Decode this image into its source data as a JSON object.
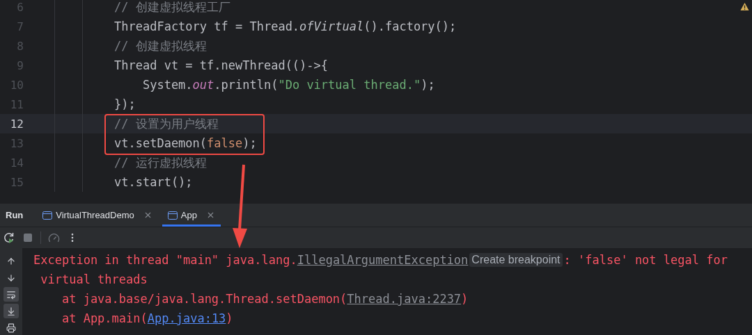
{
  "editor": {
    "warning": true,
    "lines": [
      {
        "number": "6",
        "current": false,
        "tokens": [
          {
            "kind": "comment",
            "text": "// 创建虚拟线程工厂"
          }
        ]
      },
      {
        "number": "7",
        "current": false,
        "tokens": [
          {
            "kind": "plain",
            "text": "ThreadFactory tf = Thread."
          },
          {
            "kind": "italic",
            "text": "ofVirtual"
          },
          {
            "kind": "plain",
            "text": "().factory();"
          }
        ]
      },
      {
        "number": "8",
        "current": false,
        "tokens": [
          {
            "kind": "comment",
            "text": "// 创建虚拟线程"
          }
        ]
      },
      {
        "number": "9",
        "current": false,
        "tokens": [
          {
            "kind": "plain",
            "text": "Thread vt = tf.newThread(()->{"
          }
        ]
      },
      {
        "number": "10",
        "current": false,
        "tokens": [
          {
            "kind": "plain",
            "text": "    System."
          },
          {
            "kind": "field",
            "text": "out"
          },
          {
            "kind": "plain",
            "text": ".println("
          },
          {
            "kind": "string",
            "text": "\"Do virtual thread.\""
          },
          {
            "kind": "plain",
            "text": ");"
          }
        ]
      },
      {
        "number": "11",
        "current": false,
        "tokens": [
          {
            "kind": "plain",
            "text": "});"
          }
        ]
      },
      {
        "number": "12",
        "current": true,
        "tokens": [
          {
            "kind": "comment",
            "text": "// 设置为用户线程"
          }
        ]
      },
      {
        "number": "13",
        "current": false,
        "tokens": [
          {
            "kind": "plain",
            "text": "vt.setDaemon("
          },
          {
            "kind": "keyword",
            "text": "false"
          },
          {
            "kind": "plain",
            "text": ");"
          }
        ]
      },
      {
        "number": "14",
        "current": false,
        "tokens": [
          {
            "kind": "comment",
            "text": "// 运行虚拟线程"
          }
        ]
      },
      {
        "number": "15",
        "current": false,
        "tokens": [
          {
            "kind": "plain",
            "text": "vt.start();"
          }
        ]
      }
    ]
  },
  "run_panel": {
    "title": "Run",
    "tabs": [
      {
        "label": "VirtualThreadDemo",
        "selected": false
      },
      {
        "label": "App",
        "selected": true
      }
    ],
    "toolbar": [
      {
        "kind": "rerun",
        "disabled": false
      },
      {
        "kind": "stop",
        "disabled": true
      },
      {
        "kind": "separator"
      },
      {
        "kind": "profiler",
        "disabled": true
      },
      {
        "kind": "more",
        "disabled": false
      }
    ],
    "side_actions": [
      {
        "kind": "up",
        "selected": false
      },
      {
        "kind": "down",
        "selected": false
      },
      {
        "kind": "wrap",
        "selected": true
      },
      {
        "kind": "scroll_end",
        "selected": true
      },
      {
        "kind": "print",
        "selected": false
      }
    ],
    "console": [
      [
        {
          "kind": "error",
          "text": "Exception in thread \"main\" java.lang."
        },
        {
          "kind": "source",
          "text": "IllegalArgumentException"
        },
        {
          "kind": "hint",
          "text": "Create breakpoint"
        },
        {
          "kind": "error",
          "text": ": 'false' not legal for"
        }
      ],
      [
        {
          "kind": "error",
          "text": " virtual threads"
        }
      ],
      [
        {
          "kind": "error",
          "text": "    at java.base/java.lang.Thread.setDaemon("
        },
        {
          "kind": "source",
          "text": "Thread.java:2237"
        },
        {
          "kind": "error",
          "text": ")"
        }
      ],
      [
        {
          "kind": "error",
          "text": "    at App.main("
        },
        {
          "kind": "link",
          "text": "App.java:13"
        },
        {
          "kind": "error",
          "text": ")"
        }
      ]
    ]
  }
}
